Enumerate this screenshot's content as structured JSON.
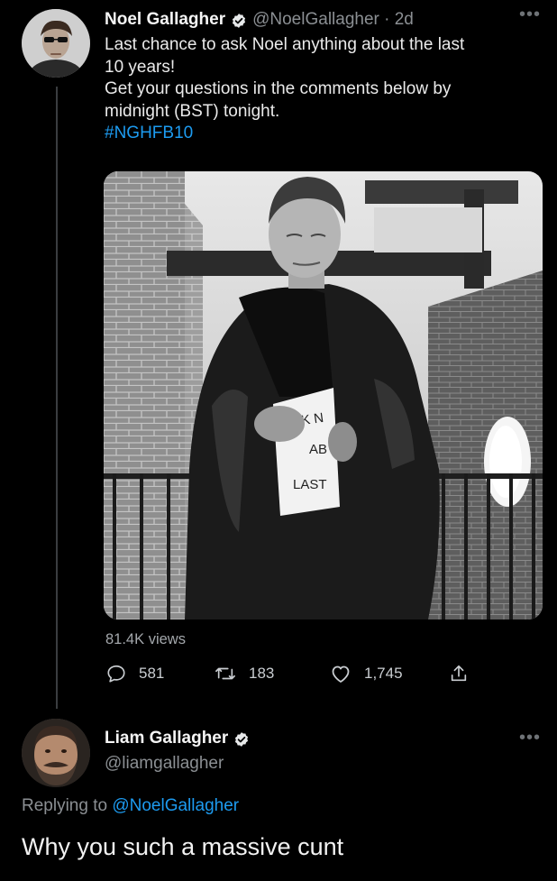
{
  "main_tweet": {
    "author": "Noel Gallagher",
    "handle_time": "@NoelGallagher · 2d",
    "line1": "Last chance to ask Noel anything about the last",
    "line2": "10 years!",
    "line3": "Get your questions in the comments below by",
    "line4": "midnight (BST) tonight.",
    "hashtag": "#NGHFB10",
    "views": "81.4K views",
    "replies": "581",
    "retweets": "183",
    "likes": "1,745"
  },
  "reply": {
    "author": "Liam Gallagher",
    "handle": "@liamgallagher",
    "replying_prefix": "Replying to ",
    "replying_to": "@NoelGallagher",
    "text": "Why you such a massive cunt"
  },
  "image_sign": {
    "line1": "ASK N",
    "line2": "AB",
    "line3": "LAST"
  },
  "colors": {
    "background": "#000000",
    "link": "#1d9bf0",
    "muted": "#8b8f93"
  },
  "icons": [
    "more-icon",
    "verified-badge-icon",
    "reply-icon",
    "retweet-icon",
    "like-icon",
    "share-icon"
  ]
}
